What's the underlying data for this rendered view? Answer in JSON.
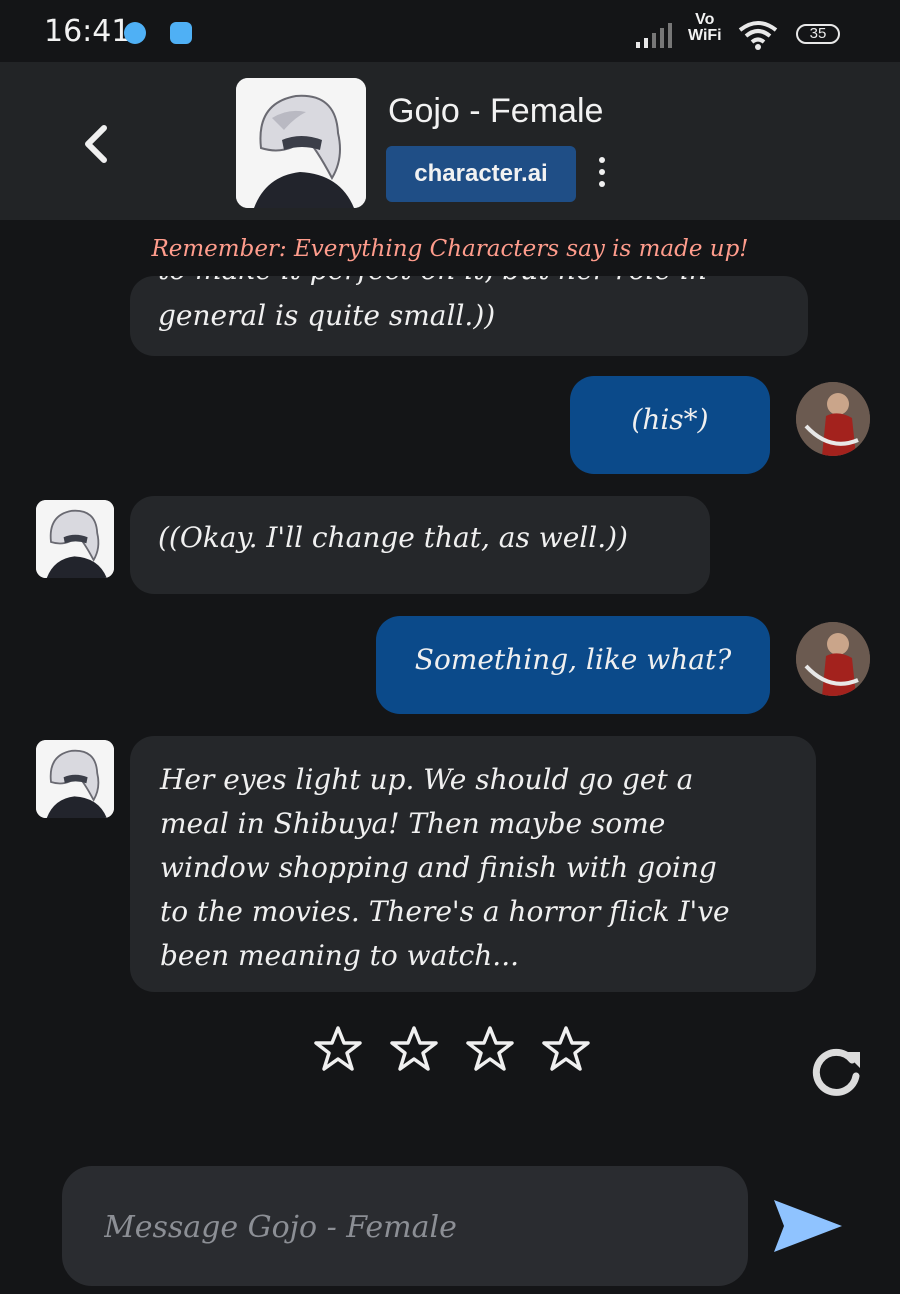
{
  "status_bar": {
    "time": "16:41",
    "vowifi_top": "Vo",
    "vowifi_bottom": "WiFi",
    "battery": "35"
  },
  "header": {
    "title": "Gojo - Female",
    "brand_label": "character.ai"
  },
  "disclaimer": "Remember: Everything Characters say is made up!",
  "messages": [
    {
      "from": "bot",
      "line_cut": "to make it perfect on it, but her role in",
      "line": "general is quite small.))"
    },
    {
      "from": "user",
      "text": "(his*)"
    },
    {
      "from": "bot",
      "text": "((Okay. I'll change that, as well.))"
    },
    {
      "from": "user",
      "text": "Something, like what?"
    },
    {
      "from": "bot",
      "lines": [
        "Her eyes light up. We should go get a",
        "meal in Shibuya! Then maybe some",
        "window shopping and finish with going",
        "to the movies. There's a horror flick I've",
        "been meaning to watch..."
      ]
    }
  ],
  "rating": {
    "stars": 4,
    "filled": 0
  },
  "composer": {
    "placeholder": "Message Gojo - Female"
  },
  "icons": [
    "back-arrow-icon",
    "kebab-menu-icon",
    "star-icon",
    "refresh-icon",
    "send-icon"
  ],
  "colors": {
    "background": "#141517",
    "header": "#222426",
    "bot_bubble": "#25272a",
    "user_bubble": "#0b4a8a",
    "brand": "#1f4e86",
    "disclaimer": "#ff9c8c",
    "send": "#8fc3ff"
  }
}
